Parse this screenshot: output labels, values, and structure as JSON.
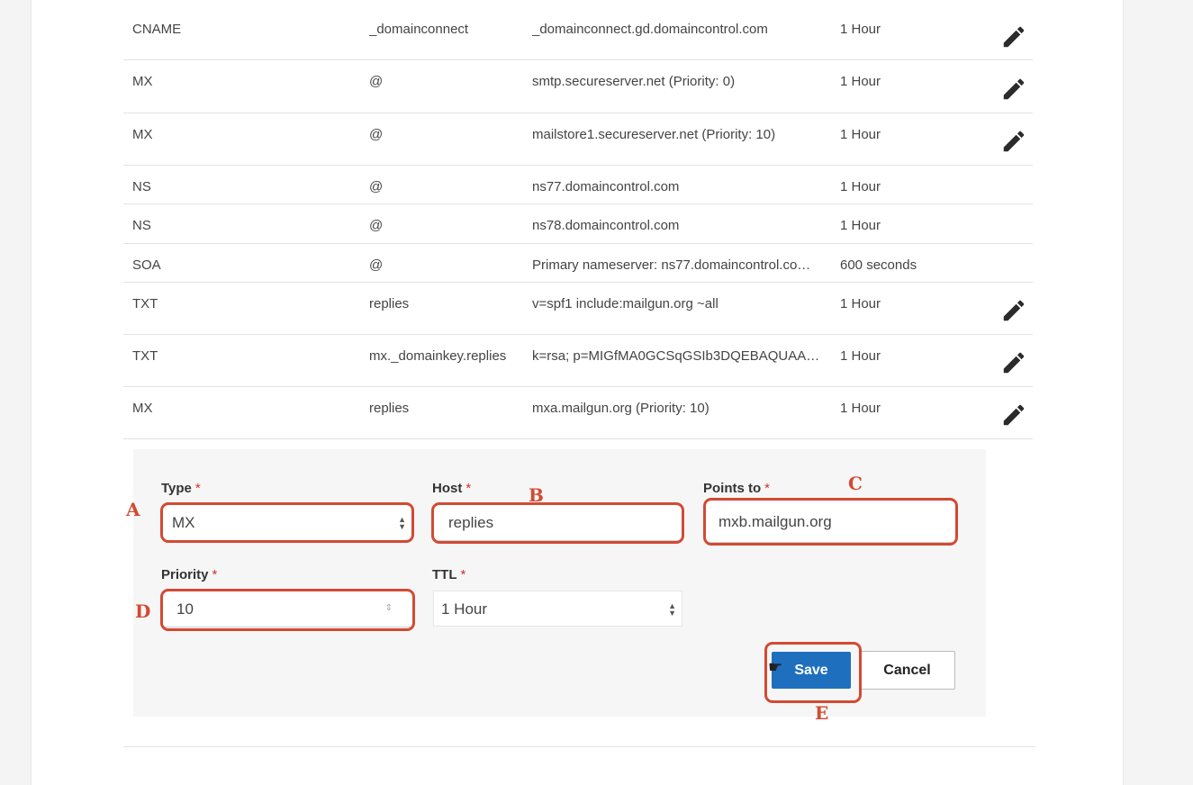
{
  "records": [
    {
      "type": "CNAME",
      "name": "_domainconnect",
      "data": "_domainconnect.gd.domaincontrol.com",
      "ttl": "1 Hour",
      "editable": true
    },
    {
      "type": "MX",
      "name": "@",
      "data": "smtp.secureserver.net (Priority: 0)",
      "ttl": "1 Hour",
      "editable": true
    },
    {
      "type": "MX",
      "name": "@",
      "data": "mailstore1.secureserver.net (Priority: 10)",
      "ttl": "1 Hour",
      "editable": true
    },
    {
      "type": "NS",
      "name": "@",
      "data": "ns77.domaincontrol.com",
      "ttl": "1 Hour",
      "editable": false
    },
    {
      "type": "NS",
      "name": "@",
      "data": "ns78.domaincontrol.com",
      "ttl": "1 Hour",
      "editable": false
    },
    {
      "type": "SOA",
      "name": "@",
      "data": "Primary nameserver: ns77.domaincontrol.co…",
      "ttl": "600 seconds",
      "editable": false
    },
    {
      "type": "TXT",
      "name": "replies",
      "data": "v=spf1 include:mailgun.org ~all",
      "ttl": "1 Hour",
      "editable": true
    },
    {
      "type": "TXT",
      "name": "mx._domainkey.replies",
      "data": "k=rsa; p=MIGfMA0GCSqGSIb3DQEBAQUAA…",
      "ttl": "1 Hour",
      "editable": true
    },
    {
      "type": "MX",
      "name": "replies",
      "data": "mxa.mailgun.org (Priority: 10)",
      "ttl": "1 Hour",
      "editable": true
    }
  ],
  "form": {
    "required_mark": "*",
    "type": {
      "label": "Type",
      "value": "MX"
    },
    "host": {
      "label": "Host",
      "value": "replies"
    },
    "points_to": {
      "label": "Points to",
      "value": "mxb.mailgun.org"
    },
    "priority": {
      "label": "Priority",
      "value": "10"
    },
    "ttl": {
      "label": "TTL",
      "value": "1 Hour"
    },
    "save_label": "Save",
    "cancel_label": "Cancel"
  },
  "markers": {
    "a": "A",
    "b": "B",
    "c": "C",
    "d": "D",
    "e": "E"
  },
  "icons": {
    "edit": "pencil-icon",
    "select": "select-arrows-icon",
    "cursor": "hand-cursor-icon"
  },
  "colors": {
    "accent": "#1f6fbf",
    "annotation": "#d24a33",
    "required": "#d0312d"
  }
}
